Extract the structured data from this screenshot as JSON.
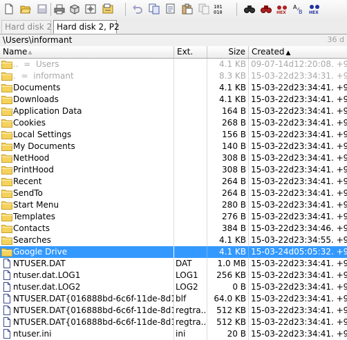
{
  "toolbar": {
    "icons": [
      "new-icon",
      "open-icon",
      "save-icon",
      "print-icon",
      "properties-icon",
      "options-icon",
      "undo-icon",
      "copy-icon",
      "cut-icon",
      "paste-icon",
      "paste-special-icon",
      "binary-icon",
      "find-icon",
      "find-text-icon",
      "find-hex-icon",
      "replace-text-icon",
      "replace-hex-icon"
    ]
  },
  "tabs": [
    {
      "label": "Hard disk 2",
      "active": false
    },
    {
      "label": "Hard disk 2, P2",
      "active": true
    }
  ],
  "path": {
    "text": "\\Users\\informant",
    "count": "36 d"
  },
  "columns": {
    "name": "Name",
    "ext": "Ext.",
    "size": "Size",
    "created": "Created"
  },
  "rows": [
    {
      "name": "Users",
      "prefix": "..",
      "ext": "",
      "size": "4.1 KB",
      "created": "09-07-14d12:20:08. +9",
      "kind": "parent"
    },
    {
      "name": "informant",
      "prefix": ".",
      "ext": "",
      "size": "8.3 KB",
      "created": "15-03-22d23:34:31. +9",
      "kind": "parent"
    },
    {
      "name": "Documents",
      "ext": "",
      "size": "4.1 KB",
      "created": "15-03-22d23:34:41. +9",
      "kind": "folder"
    },
    {
      "name": "Downloads",
      "ext": "",
      "size": "4.1 KB",
      "created": "15-03-22d23:34:41. +9",
      "kind": "folder"
    },
    {
      "name": "Application Data",
      "ext": "",
      "size": "164 B",
      "created": "15-03-22d23:34:41. +9",
      "kind": "folder"
    },
    {
      "name": "Cookies",
      "ext": "",
      "size": "268 B",
      "created": "15-03-22d23:34:41. +9",
      "kind": "folder"
    },
    {
      "name": "Local Settings",
      "ext": "",
      "size": "156 B",
      "created": "15-03-22d23:34:41. +9",
      "kind": "folder"
    },
    {
      "name": "My Documents",
      "ext": "",
      "size": "140 B",
      "created": "15-03-22d23:34:41. +9",
      "kind": "folder"
    },
    {
      "name": "NetHood",
      "ext": "",
      "size": "308 B",
      "created": "15-03-22d23:34:41. +9",
      "kind": "folder"
    },
    {
      "name": "PrintHood",
      "ext": "",
      "size": "308 B",
      "created": "15-03-22d23:34:41. +9",
      "kind": "folder"
    },
    {
      "name": "Recent",
      "ext": "",
      "size": "264 B",
      "created": "15-03-22d23:34:41. +9",
      "kind": "folder"
    },
    {
      "name": "SendTo",
      "ext": "",
      "size": "264 B",
      "created": "15-03-22d23:34:41. +9",
      "kind": "folder"
    },
    {
      "name": "Start Menu",
      "ext": "",
      "size": "280 B",
      "created": "15-03-22d23:34:41. +9",
      "kind": "folder"
    },
    {
      "name": "Templates",
      "ext": "",
      "size": "276 B",
      "created": "15-03-22d23:34:41. +9",
      "kind": "folder"
    },
    {
      "name": "Contacts",
      "ext": "",
      "size": "384 B",
      "created": "15-03-22d23:34:46. +9",
      "kind": "folder"
    },
    {
      "name": "Searches",
      "ext": "",
      "size": "4.1 KB",
      "created": "15-03-22d23:34:55. +9",
      "kind": "folder"
    },
    {
      "name": "Google Drive",
      "ext": "",
      "size": "4.1 KB",
      "created": "15-03-24d05:05:32. +9",
      "kind": "folder",
      "selected": true
    },
    {
      "name": "NTUSER.DAT",
      "ext": "DAT",
      "size": "1.0 MB",
      "created": "15-03-22d23:34:41. +9",
      "kind": "file"
    },
    {
      "name": "ntuser.dat.LOG1",
      "ext": "LOG1",
      "size": "256 KB",
      "created": "15-03-22d23:34:41. +9",
      "kind": "file"
    },
    {
      "name": "ntuser.dat.LOG2",
      "ext": "LOG2",
      "size": "0 B",
      "created": "15-03-22d23:34:41. +9",
      "kind": "file"
    },
    {
      "name": "NTUSER.DAT{016888bd-6c6f-11de-8d1d...",
      "ext": "blf",
      "size": "64.0 KB",
      "created": "15-03-22d23:34:41. +9",
      "kind": "file"
    },
    {
      "name": "NTUSER.DAT{016888bd-6c6f-11de-8d1d...",
      "ext": "regtra...",
      "size": "512 KB",
      "created": "15-03-22d23:34:41. +9",
      "kind": "file"
    },
    {
      "name": "NTUSER.DAT{016888bd-6c6f-11de-8d1d...",
      "ext": "regtra...",
      "size": "512 KB",
      "created": "15-03-22d23:34:41. +9",
      "kind": "file"
    },
    {
      "name": "ntuser.ini",
      "ext": "ini",
      "size": "20 B",
      "created": "15-03-22d23:34:41. +9",
      "kind": "file"
    }
  ],
  "colors": {
    "selection": "#3399ff",
    "folder": "#f5d25c",
    "folder_edge": "#c8a02c"
  }
}
